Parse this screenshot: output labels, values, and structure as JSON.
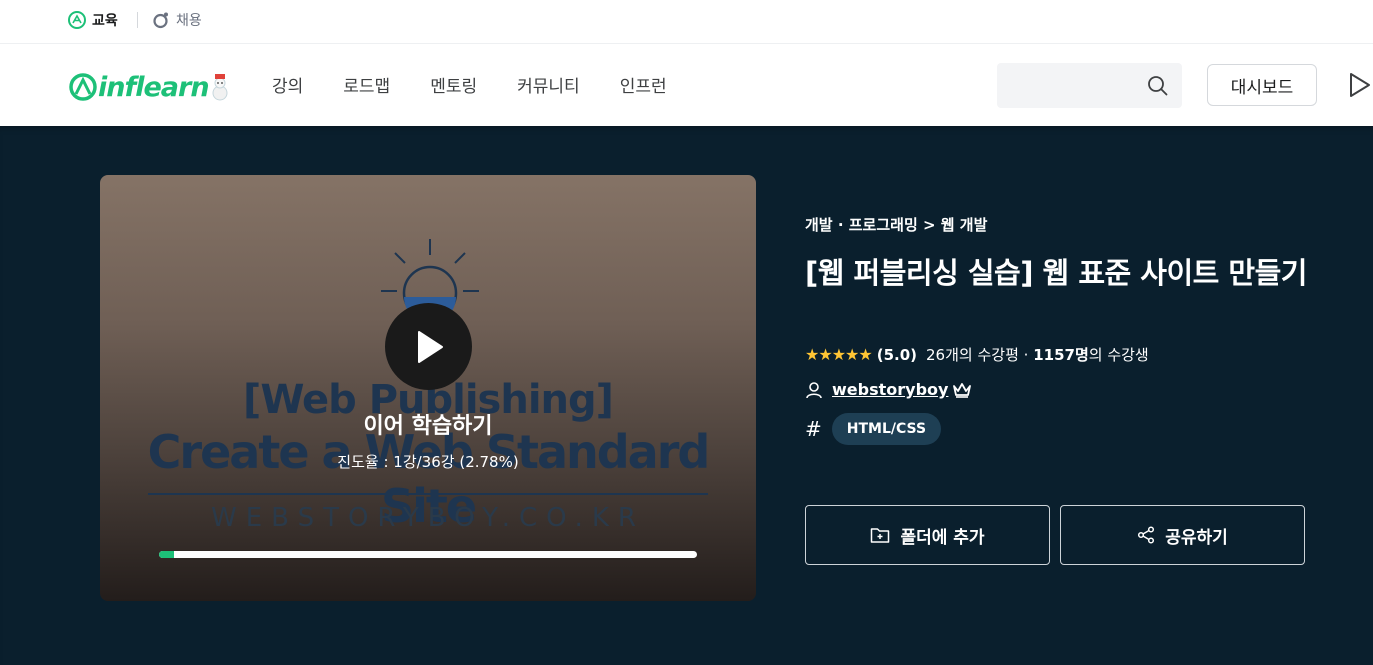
{
  "topbar": {
    "education_label": "교육",
    "jobs_label": "채용"
  },
  "nav": {
    "logo_text": "inflearn",
    "menu": [
      "강의",
      "로드맵",
      "멘토링",
      "커뮤니티",
      "인프런"
    ],
    "search_placeholder": "",
    "dashboard_label": "대시보드"
  },
  "course": {
    "thumbnail": {
      "title_line1": "[Web Publishing]",
      "title_line2": "Create a Web Standard Site",
      "site": "WEBSTORYBOY.CO.KR"
    },
    "resume_label": "이어 학습하기",
    "progress_text": "진도율 : 1강/36강 (2.78%)",
    "progress_fraction": 0.0278,
    "breadcrumb": "개발 · 프로그래밍 > 웹 개발",
    "title": "[웹 퍼블리싱 실습] 웹 표준 사이트 만들기",
    "stars": "★★★★★",
    "rating": "(5.0)",
    "review_text": "26개의 수강평 ·",
    "students_count": "1157명",
    "students_suffix": "의 수강생",
    "instructor": "webstoryboy",
    "tag": "HTML/CSS",
    "add_folder_label": "폴더에 추가",
    "share_label": "공유하기"
  },
  "colors": {
    "brand": "#1dc078",
    "hero_bg": "#0a1f2d",
    "star": "#ffc534"
  },
  "icons": [
    "education-icon",
    "jobs-icon",
    "search-icon",
    "play-icon",
    "user-icon",
    "crown-icon",
    "hash-icon",
    "folder-plus-icon",
    "share-icon"
  ]
}
